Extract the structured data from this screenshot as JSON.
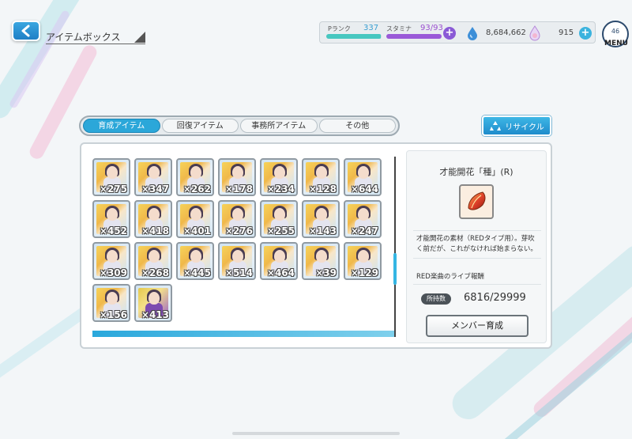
{
  "header": {
    "title": "アイテムボックス",
    "p_rank_label": "Pランク",
    "p_rank_value": "337",
    "p_rank_progress": 0.98,
    "stamina_label": "スタミナ",
    "stamina_value": "93/93",
    "stamina_progress": 1.0,
    "money_value": "8,684,662",
    "gem_value": "915",
    "menu_badge": "46",
    "menu_label": "MENU"
  },
  "tabs": [
    {
      "label": "育成アイテム",
      "active": true
    },
    {
      "label": "回復アイテム",
      "active": false
    },
    {
      "label": "事務所アイテム",
      "active": false
    },
    {
      "label": "その他",
      "active": false
    }
  ],
  "recycle_label": "リサイクル",
  "items": [
    {
      "qty": "×275"
    },
    {
      "qty": "×347"
    },
    {
      "qty": "×262"
    },
    {
      "qty": "×178"
    },
    {
      "qty": "×234"
    },
    {
      "qty": "×128"
    },
    {
      "qty": "×644"
    },
    {
      "qty": "×452"
    },
    {
      "qty": "×418"
    },
    {
      "qty": "×401"
    },
    {
      "qty": "×276"
    },
    {
      "qty": "×255"
    },
    {
      "qty": "×143"
    },
    {
      "qty": "×247"
    },
    {
      "qty": "×309"
    },
    {
      "qty": "×268"
    },
    {
      "qty": "×445"
    },
    {
      "qty": "×514"
    },
    {
      "qty": "×464"
    },
    {
      "qty": "×39"
    },
    {
      "qty": "×129"
    },
    {
      "qty": "×156"
    },
    {
      "qty": "×413",
      "special": true
    }
  ],
  "detail": {
    "title": "才能開花「種」(R)",
    "description": "才能開花の素材（REDタイプ用）。芽吹く前だが、これがなければ始まらない。",
    "source": "RED楽曲のライブ報酬",
    "owned_label": "所持数",
    "owned_value": "6816/29999",
    "member_button": "メンバー育成"
  },
  "colors": {
    "accent": "#2ba7d9",
    "stamina": "#9a5ad8",
    "p_rank": "#47c7c0"
  }
}
